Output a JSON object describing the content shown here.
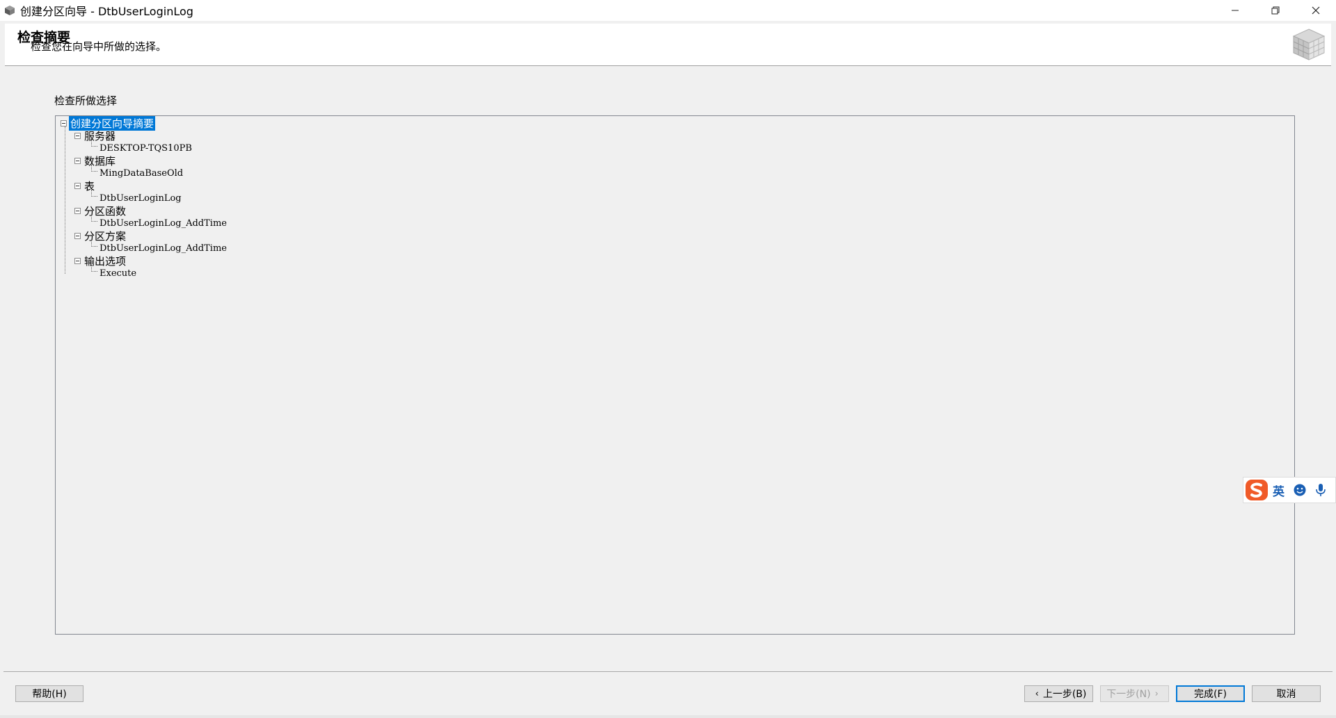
{
  "window": {
    "title": "创建分区向导 - DtbUserLoginLog",
    "controls": {
      "minimize": "—",
      "restore": "❐",
      "close": "✕"
    }
  },
  "header": {
    "title": "检查摘要",
    "subtitle": "检查您在向导中所做的选择。"
  },
  "section_label": "检查所做选择",
  "tree": {
    "root": "创建分区向导摘要",
    "groups": [
      {
        "label": "服务器",
        "value": "DESKTOP-TQS10PB"
      },
      {
        "label": "数据库",
        "value": "MingDataBaseOld"
      },
      {
        "label": "表",
        "value": "DtbUserLoginLog"
      },
      {
        "label": "分区函数",
        "value": "DtbUserLoginLog_AddTime"
      },
      {
        "label": "分区方案",
        "value": "DtbUserLoginLog_AddTime"
      },
      {
        "label": "输出选项",
        "value": "Execute"
      }
    ]
  },
  "buttons": {
    "help": "帮助(H)",
    "back": "上一步(B)",
    "next": "下一步(N)",
    "finish": "完成(F)",
    "cancel": "取消"
  },
  "ime": {
    "language": "英"
  },
  "colors": {
    "selection": "#0078d7",
    "ime_logo": "#f05a28",
    "ime_accent": "#1a5fb4"
  }
}
